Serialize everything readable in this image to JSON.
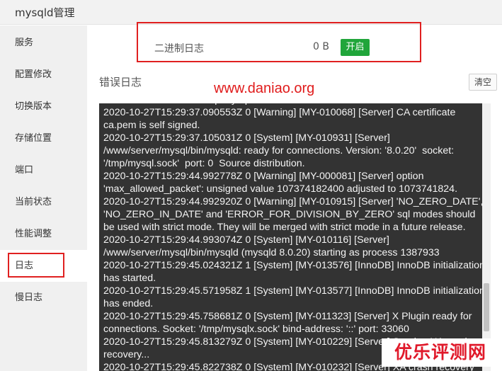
{
  "window": {
    "title": "mysqld管理"
  },
  "sidebar": {
    "items": [
      {
        "label": "服务"
      },
      {
        "label": "配置修改"
      },
      {
        "label": "切换版本"
      },
      {
        "label": "存储位置"
      },
      {
        "label": "端口"
      },
      {
        "label": "当前状态"
      },
      {
        "label": "性能调整"
      },
      {
        "label": "日志",
        "active": true
      },
      {
        "label": "慢日志"
      }
    ]
  },
  "binlog": {
    "label": "二进制日志",
    "size": "0 B",
    "toggle_label": "开启",
    "toggle_color": "#20a53a"
  },
  "error_log": {
    "title": "错误日志",
    "clear_label": "清空",
    "lines": "connections. Socket: '/tmp/mysqlx.sock'\n2020-10-27T15:29:37.090553Z 0 [Warning] [MY-010068] [Server] CA certificate ca.pem is self signed.\n2020-10-27T15:29:37.105031Z 0 [System] [MY-010931] [Server] /www/server/mysql/bin/mysqld: ready for connections. Version: '8.0.20'  socket: '/tmp/mysql.sock'  port: 0  Source distribution.\n2020-10-27T15:29:44.992778Z 0 [Warning] [MY-000081] [Server] option 'max_allowed_packet': unsigned value 107374182400 adjusted to 1073741824.\n2020-10-27T15:29:44.992920Z 0 [Warning] [MY-010915] [Server] 'NO_ZERO_DATE', 'NO_ZERO_IN_DATE' and 'ERROR_FOR_DIVISION_BY_ZERO' sql modes should be used with strict mode. They will be merged with strict mode in a future release.\n2020-10-27T15:29:44.993074Z 0 [System] [MY-010116] [Server] /www/server/mysql/bin/mysqld (mysqld 8.0.20) starting as process 1387933\n2020-10-27T15:29:45.024321Z 1 [System] [MY-013576] [InnoDB] InnoDB initialization has started.\n2020-10-27T15:29:45.571958Z 1 [System] [MY-013577] [InnoDB] InnoDB initialization has ended.\n2020-10-27T15:29:45.758681Z 0 [System] [MY-011323] [Server] X Plugin ready for connections. Socket: '/tmp/mysqlx.sock' bind-address: '::' port: 33060\n2020-10-27T15:29:45.813279Z 0 [System] [MY-010229] [Server] Starting XA crash recovery...\n2020-10-27T15:29:45.822738Z 0 [System] [MY-010232] [Server] XA crash recovery finished."
  },
  "watermarks": {
    "url": "www.daniao.org",
    "corner": "优乐评测网",
    "color": "#e01b1b"
  },
  "highlight_color": "#e02020"
}
